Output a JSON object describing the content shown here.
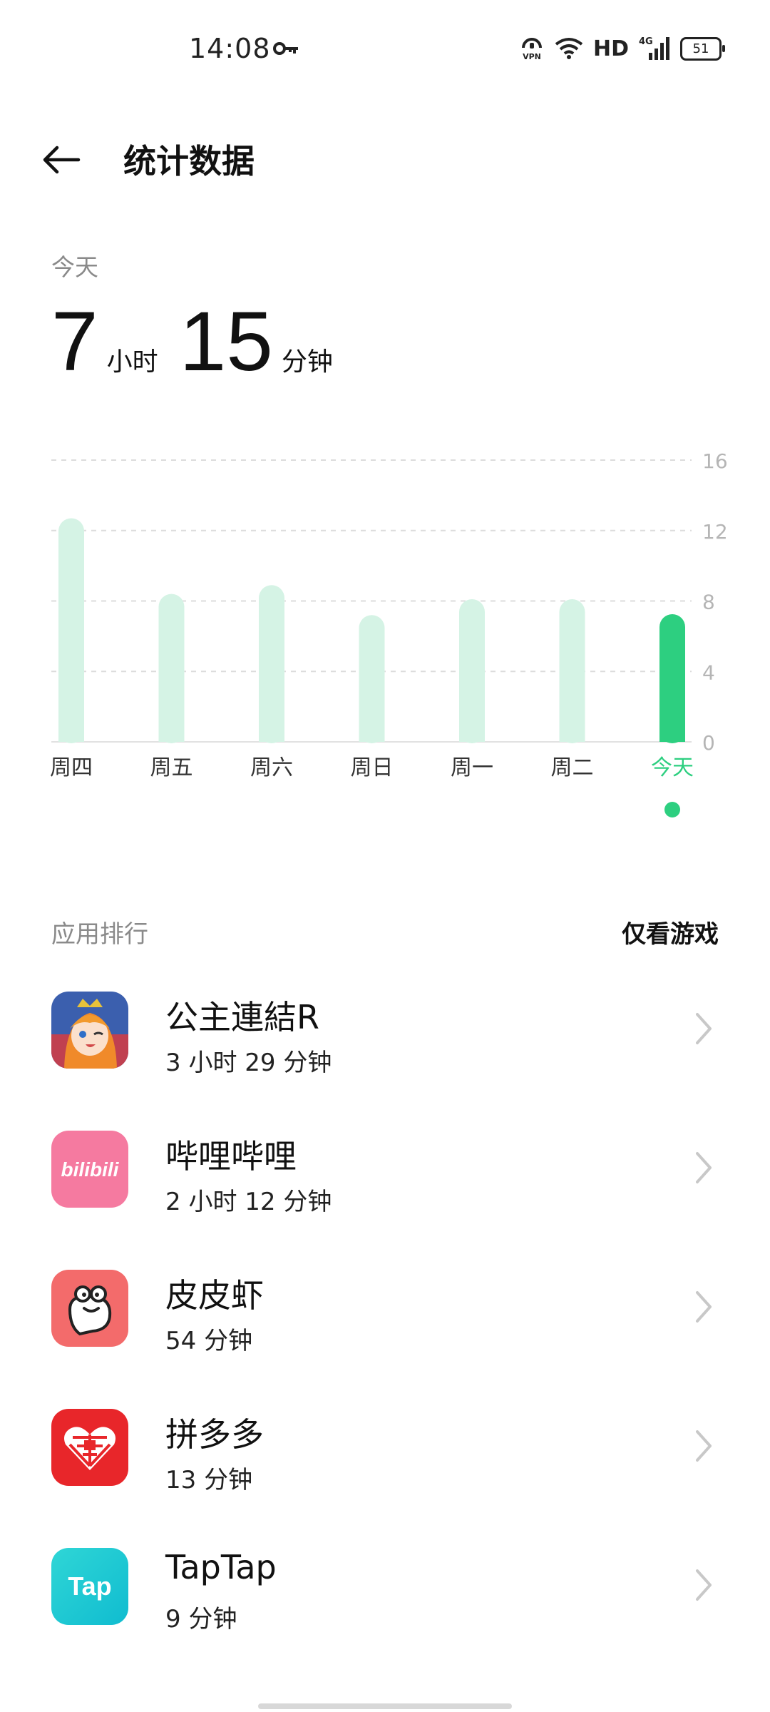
{
  "status_bar": {
    "time": "14:08",
    "vpn_label": "VPN",
    "network_label": "HD",
    "signal_label": "4G",
    "battery_level": "51",
    "icons": [
      "key-icon",
      "vpn-icon",
      "wifi-icon",
      "signal-icon",
      "battery-icon"
    ]
  },
  "header": {
    "title": "统计数据",
    "back_icon": "arrow-left-icon"
  },
  "summary": {
    "period_label": "今天",
    "hours": "7",
    "hours_unit": "小时",
    "minutes": "15",
    "minutes_unit": "分钟"
  },
  "chart_data": {
    "type": "bar",
    "categories": [
      "周四",
      "周五",
      "周六",
      "周日",
      "周一",
      "周二",
      "今天"
    ],
    "values": [
      12.7,
      8.4,
      8.9,
      7.2,
      8.1,
      8.1,
      7.25
    ],
    "highlight_index": 6,
    "ylim": [
      0,
      16
    ],
    "yticks": [
      0,
      4,
      8,
      12,
      16
    ],
    "grid": true,
    "colors": {
      "bar": "#d5f3e5",
      "highlight": "#2dcf80",
      "grid": "#dcdcdc",
      "tick": "#b5b5b5",
      "axis": "#333333"
    }
  },
  "ranking": {
    "title": "应用排行",
    "filter_label": "仅看游戏",
    "apps": [
      {
        "name": "公主連結R",
        "usage": "3 小时 29 分钟",
        "icon": "princess-connect-icon"
      },
      {
        "name": "哔哩哔哩",
        "usage": "2 小时 12 分钟",
        "icon": "bilibili-icon",
        "icon_text": "bilibili"
      },
      {
        "name": "皮皮虾",
        "usage": "54 分钟",
        "icon": "pipixia-icon"
      },
      {
        "name": "拼多多",
        "usage": "13 分钟",
        "icon": "pinduoduo-icon"
      },
      {
        "name": "TapTap",
        "usage": "9 分钟",
        "icon": "taptap-icon",
        "icon_text": "Tap"
      }
    ]
  }
}
